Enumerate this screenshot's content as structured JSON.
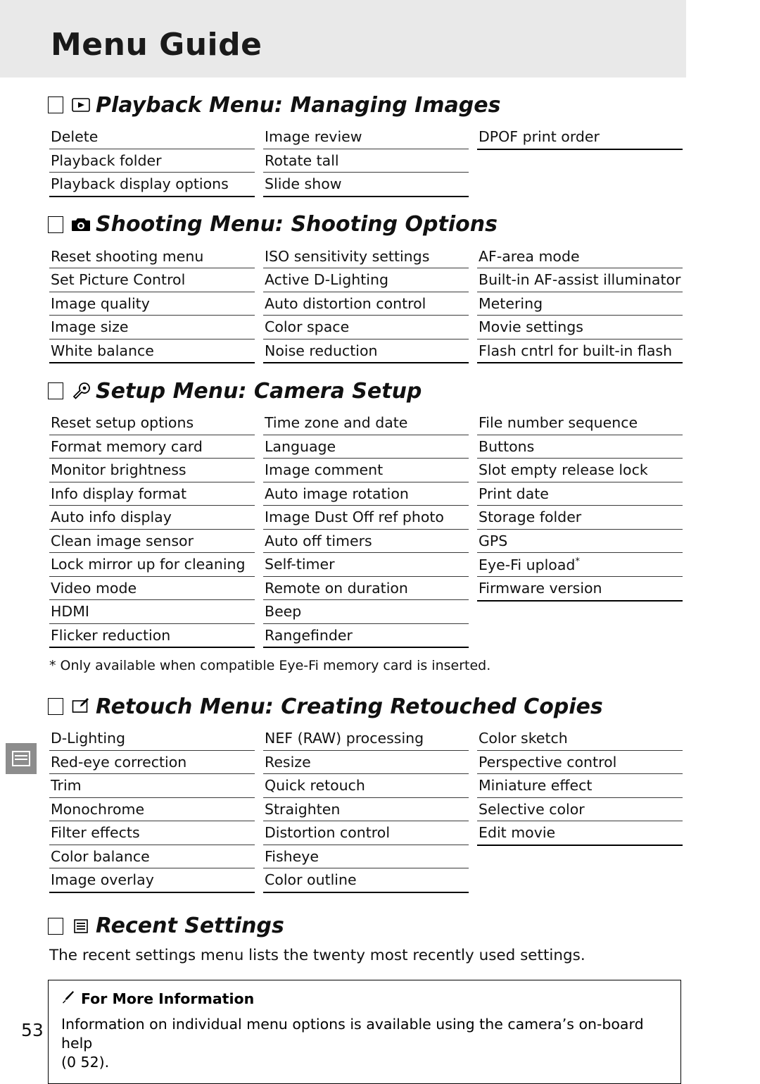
{
  "header": {
    "title": "Menu Guide"
  },
  "sections": [
    {
      "id": "playback",
      "marker": "square",
      "icon": "playback-icon",
      "title": "Playback Menu: Managing Images",
      "columns": [
        [
          "Delete",
          "Playback folder",
          "Playback display options"
        ],
        [
          "Image review",
          "Rotate tall",
          "Slide show"
        ],
        [
          "DPOF print order"
        ]
      ]
    },
    {
      "id": "shooting",
      "marker": "square",
      "icon": "camera-icon",
      "title": "Shooting Menu: Shooting Options",
      "columns": [
        [
          "Reset shooting menu",
          "Set Picture Control",
          "Image quality",
          "Image size",
          "White balance"
        ],
        [
          "ISO sensitivity settings",
          "Active D-Lighting",
          "Auto distortion control",
          "Color space",
          "Noise reduction"
        ],
        [
          "AF-area mode",
          "Built-in AF-assist illuminator",
          "Metering",
          "Movie settings",
          "Flash cntrl for built-in flash"
        ]
      ]
    },
    {
      "id": "setup",
      "marker": "square",
      "icon": "wrench-icon",
      "title": "Setup Menu: Camera Setup",
      "columns": [
        [
          "Reset setup options",
          "Format memory card",
          "Monitor brightness",
          "Info display format",
          "Auto info display",
          "Clean image sensor",
          "Lock mirror up for cleaning",
          "Video mode",
          "HDMI",
          "Flicker reduction"
        ],
        [
          "Time zone and date",
          "Language",
          "Image comment",
          "Auto image rotation",
          "Image Dust Off ref photo",
          "Auto off timers",
          "Self-timer",
          "Remote on duration",
          "Beep",
          "Rangefinder"
        ],
        [
          "File number sequence",
          "Buttons",
          "Slot empty release lock",
          "Print date",
          "Storage folder",
          "GPS",
          "Eye-Fi upload",
          "Firmware version"
        ]
      ],
      "footnote": "* Only available when compatible Eye-Fi memory card is inserted."
    },
    {
      "id": "retouch",
      "marker": "square",
      "icon": "retouch-icon",
      "title": "Retouch Menu: Creating Retouched Copies",
      "columns": [
        [
          "D-Lighting",
          "Red-eye correction",
          "Trim",
          "Monochrome",
          "Filter effects",
          "Color balance",
          "Image overlay"
        ],
        [
          "NEF (RAW) processing",
          "Resize",
          "Quick retouch",
          "Straighten",
          "Distortion control",
          "Fisheye",
          "Color outline"
        ],
        [
          "Color sketch",
          "Perspective control",
          "Miniature effect",
          "Selective color",
          "Edit movie"
        ]
      ]
    },
    {
      "id": "recent",
      "marker": "square",
      "icon": "recent-settings-icon",
      "title": "Recent Settings",
      "paragraph": "The recent settings menu lists the twenty most recently used settings."
    }
  ],
  "note": {
    "icon": "pencil-icon",
    "title": "For More Information",
    "body": "Information on individual menu options is available using the camera’s on-board help",
    "reference": "(0 52)."
  },
  "page_number": "53",
  "colors": {
    "header_band": "#e9e9e9",
    "tab_marker": "#8d8d8d",
    "text": "#111111"
  }
}
